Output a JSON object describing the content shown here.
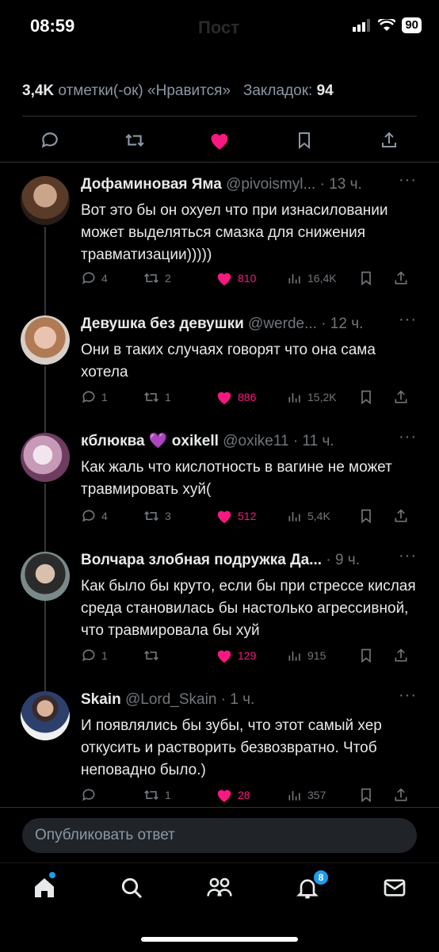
{
  "status_bar": {
    "time": "08:59",
    "battery": "90"
  },
  "header": {
    "title": "Пост"
  },
  "stats": {
    "likes_count": "3,4K",
    "likes_label": "отметки(-ок) «Нравится»",
    "bookmarks_label": "Закладок:",
    "bookmarks_count": "94"
  },
  "replies": [
    {
      "name": "Дофаминовая Яма",
      "handle": "@pivoismyl...",
      "time": "· 13 ч.",
      "text": "Вот это бы он охуел что при изнасиловании может выделяться смазка для снижения травматизации)))))",
      "comments": "4",
      "reposts": "2",
      "likes": "810",
      "views": "16,4K"
    },
    {
      "name": "Девушка без девушки",
      "handle": "@werde...",
      "time": "· 12 ч.",
      "text": "Они в таких случаях говорят что она сама хотела",
      "comments": "1",
      "reposts": "1",
      "likes": "886",
      "views": "15,2K"
    },
    {
      "name": "кблюква 💜 oxikell",
      "handle": "@oxike11",
      "time": "· 11 ч.",
      "text": "Как жаль что кислотность в вагине не может травмировать хуй(",
      "comments": "4",
      "reposts": "3",
      "likes": "512",
      "views": "5,4K"
    },
    {
      "name": "Волчара злобная подружка Да...",
      "handle": "",
      "time": "· 9 ч.",
      "text": "Как было бы круто, если бы при стрессе кислая среда становилась бы настолько агрессивной, что травмировала бы хуй",
      "comments": "1",
      "reposts": "",
      "likes": "129",
      "views": "915"
    },
    {
      "name": "Skain",
      "handle": "@Lord_Skain",
      "time": "· 1 ч.",
      "text": "И появлялись бы зубы, что этот самый хер откусить и растворить безвозвратно. Чтоб неповадно было.)",
      "comments": "",
      "reposts": "1",
      "likes": "28",
      "views": "357"
    }
  ],
  "composer": {
    "placeholder": "Опубликовать ответ"
  },
  "tabbar": {
    "notifications_badge": "8"
  },
  "colors": {
    "like": "#f91880",
    "muted": "#71767b",
    "accent": "#1d9bf0"
  }
}
